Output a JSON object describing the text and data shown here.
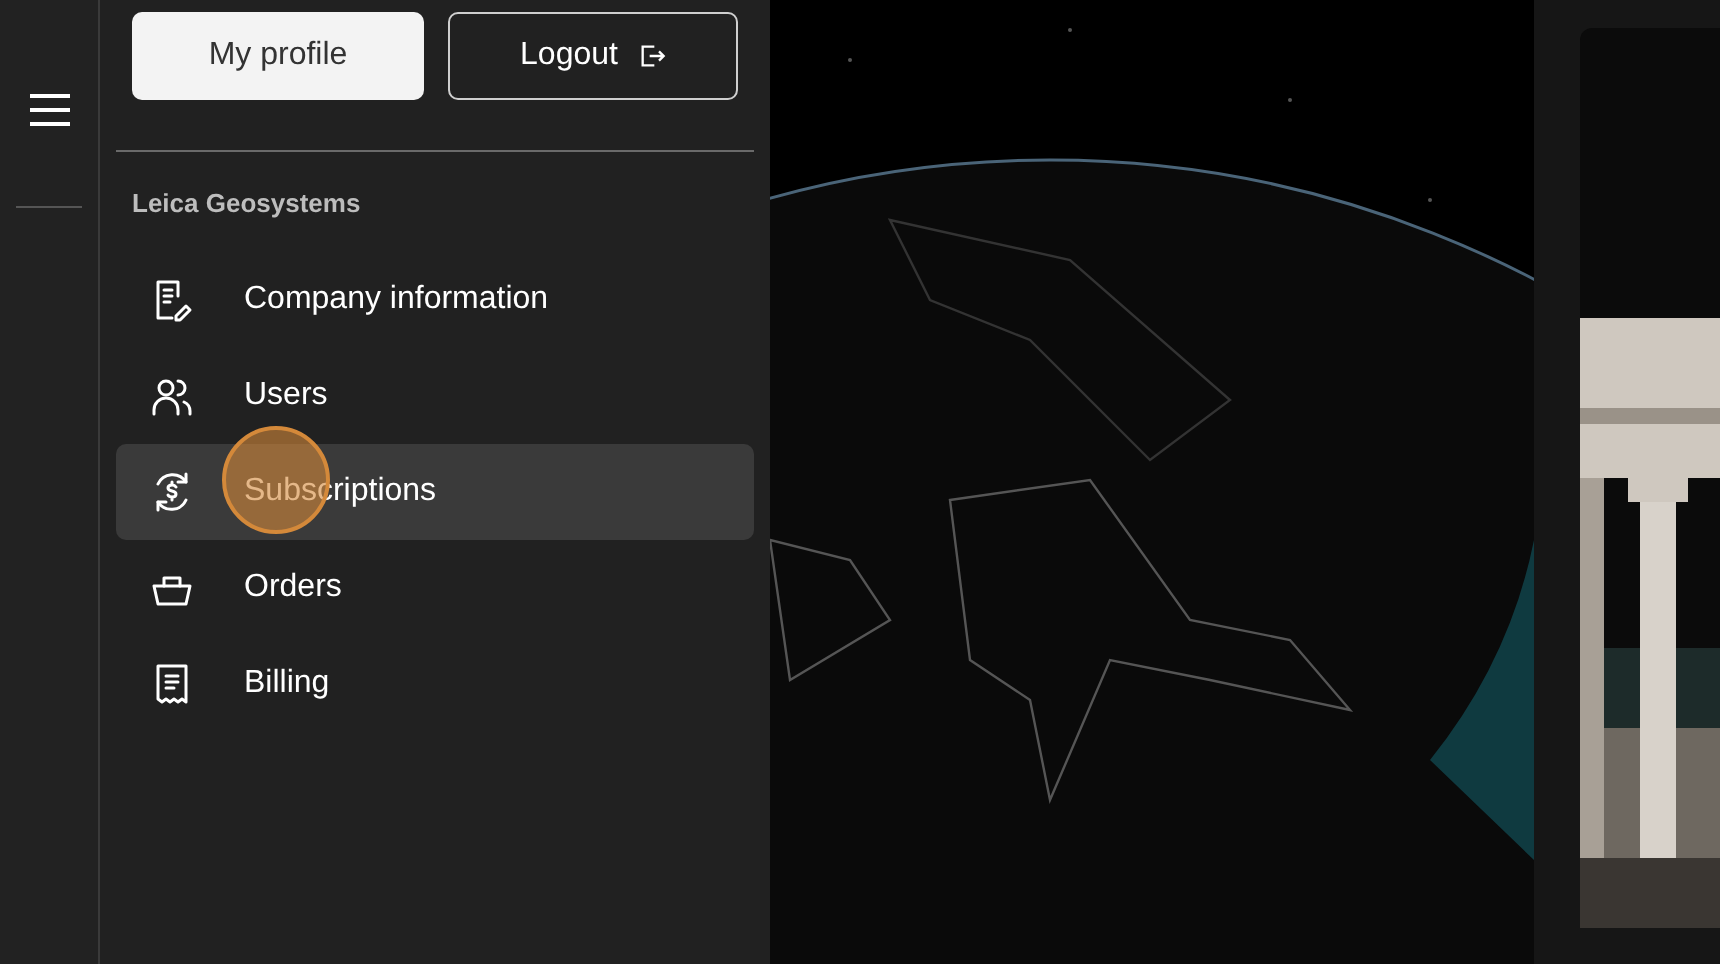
{
  "account_buttons": [
    {
      "kind": "profile",
      "label": "My profile"
    },
    {
      "kind": "logout",
      "label": "Logout"
    }
  ],
  "organization": "Leica Geosystems",
  "menu_items": [
    {
      "kind": "company",
      "label": "Company information",
      "selected": false
    },
    {
      "kind": "users",
      "label": "Users",
      "selected": false
    },
    {
      "kind": "subscriptions",
      "label": "Subscriptions",
      "selected": true
    },
    {
      "kind": "orders",
      "label": "Orders",
      "selected": false
    },
    {
      "kind": "billing",
      "label": "Billing",
      "selected": false
    }
  ]
}
